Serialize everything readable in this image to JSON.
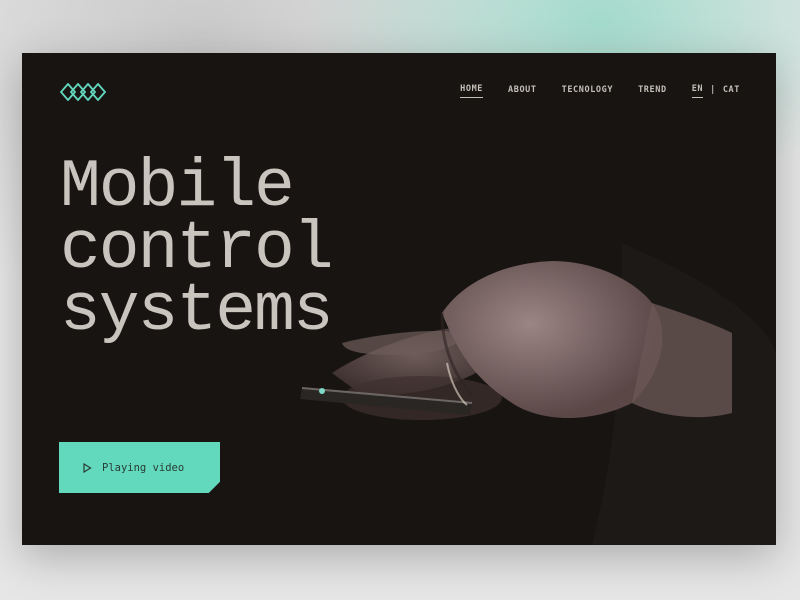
{
  "brand": {
    "logo_icon": "linked-diamonds-logo",
    "accent_color": "#62d8bd"
  },
  "nav": {
    "items": [
      {
        "label": "HOME",
        "active": true
      },
      {
        "label": "ABOUT",
        "active": false
      },
      {
        "label": "TECNOLOGY",
        "active": false
      },
      {
        "label": "TREND",
        "active": false
      }
    ],
    "language": {
      "active": "EN",
      "separator": "|",
      "other": "CAT"
    }
  },
  "hero": {
    "title_lines": [
      "Mobile",
      "control",
      "systems"
    ],
    "cta": {
      "label": "Playing video",
      "icon": "play-icon"
    },
    "image_alt": "Hands holding a smartphone in the dark"
  }
}
